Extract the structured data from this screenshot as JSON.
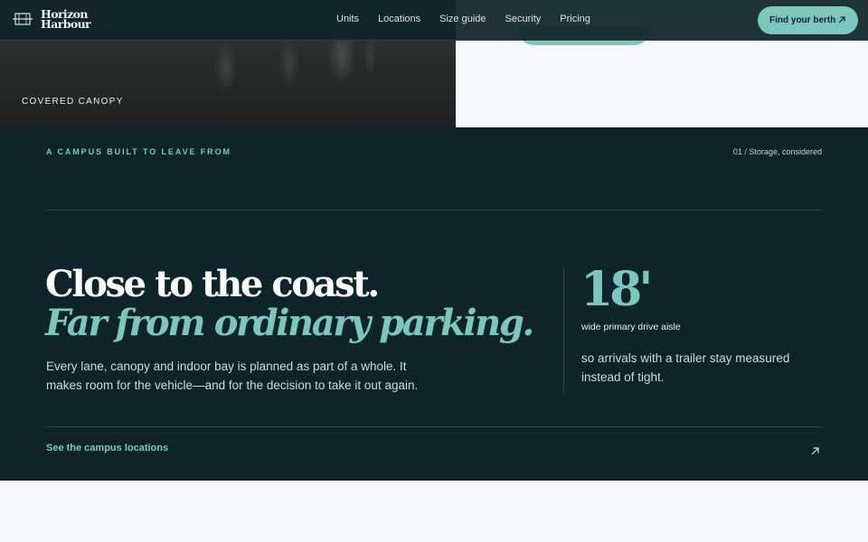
{
  "header": {
    "logo_line1": "Horizon",
    "logo_line2": "Harbour",
    "nav": [
      "Units",
      "Locations",
      "Size guide",
      "Security",
      "Pricing"
    ],
    "cta_label": "Find your berth"
  },
  "hero": {
    "photo_caption": "COVERED CANOPY"
  },
  "section": {
    "eyebrow": "A CAMPUS BUILT TO LEAVE FROM",
    "kicker": "01 / Storage, considered",
    "headline": "Close to the coast.",
    "headline_italic": "Far from ordinary parking.",
    "body": "Every lane, canopy and indoor bay is planned as part of a whole. It makes room for the vehicle—and for the decision to take it out again.",
    "stat_number": "18'",
    "stat_label": "wide primary drive aisle",
    "stat_copy": "so arrivals with a trailer stay measured instead of tight.",
    "link_label": "See the campus locations"
  },
  "colors": {
    "accent": "#7cc7bd",
    "dark_bg": "#0f232a",
    "light_bg": "#f3f9fa"
  },
  "icons": {
    "logo": "harbour-logo-icon",
    "cta": "arrow-up-right-icon",
    "link": "arrow-up-right-icon"
  }
}
